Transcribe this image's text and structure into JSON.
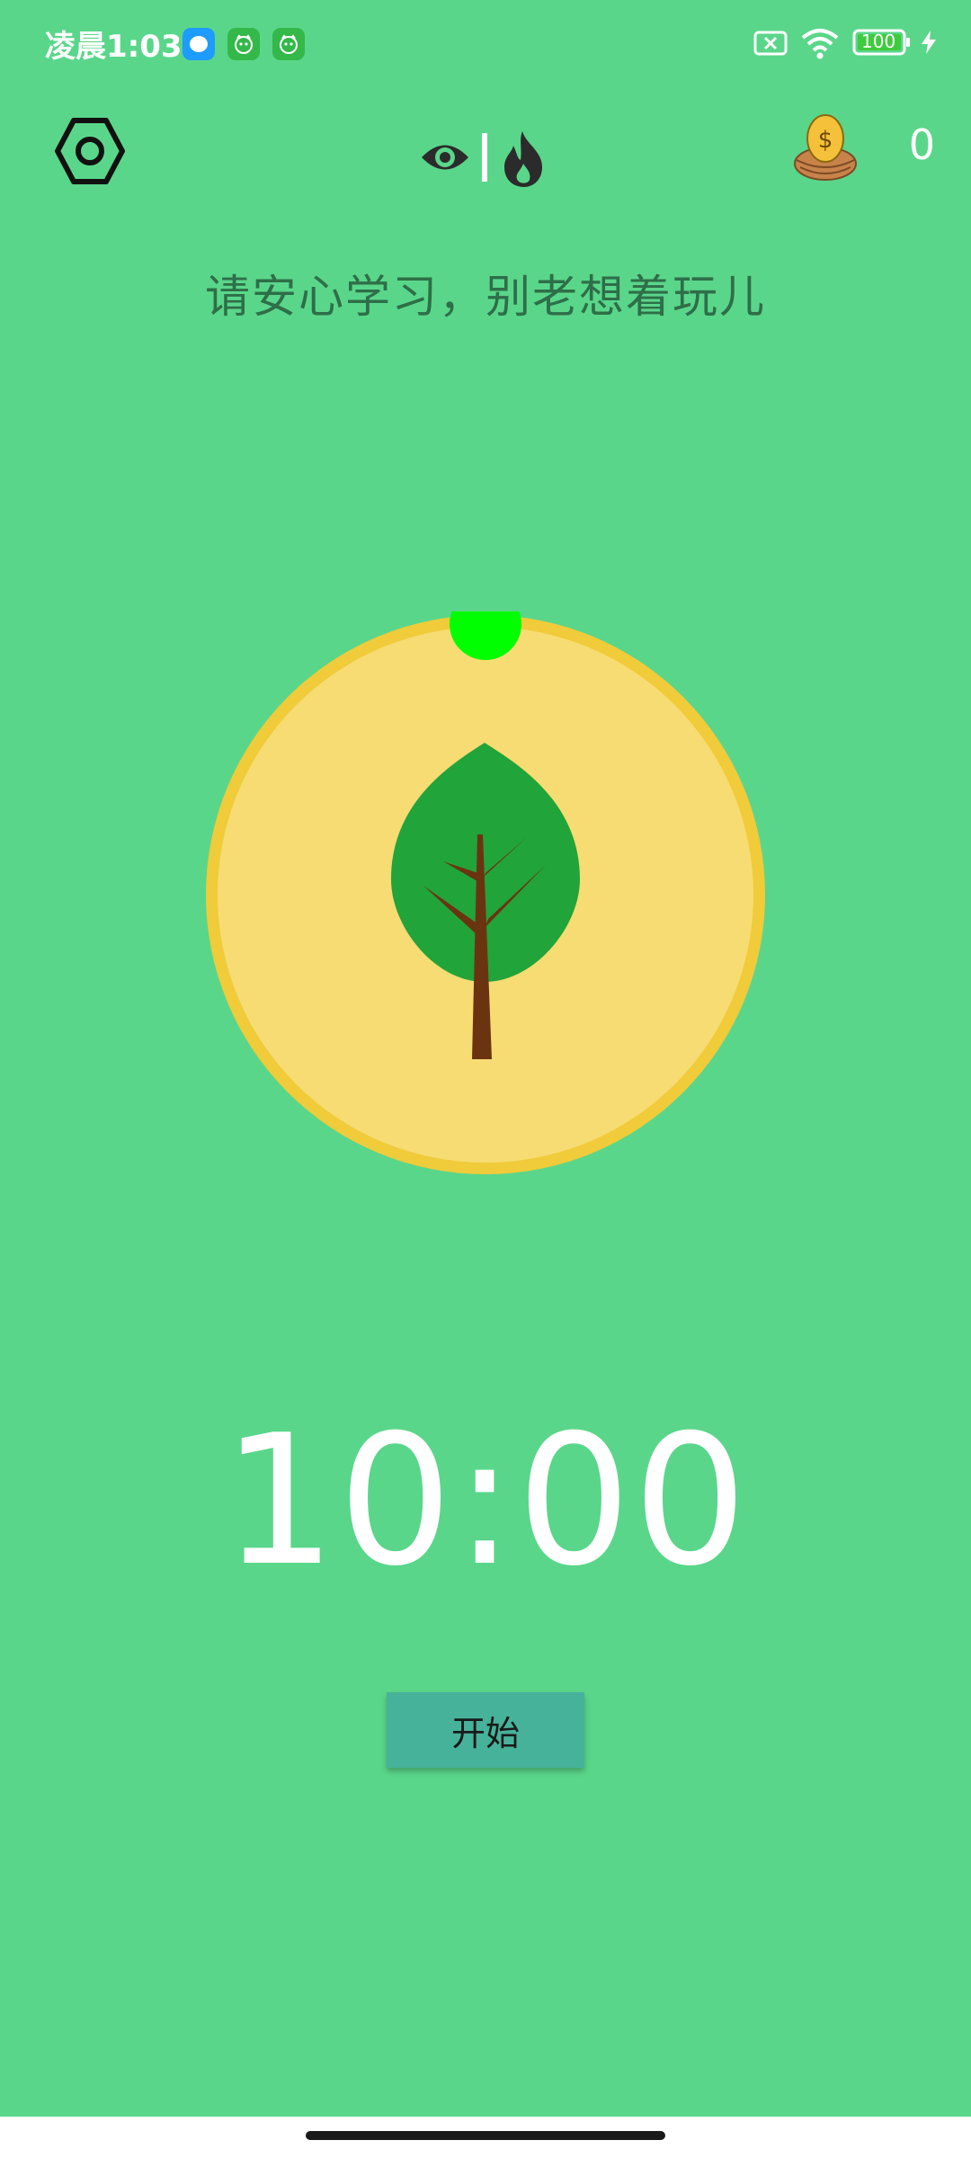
{
  "status_bar": {
    "time": "凌晨1:03",
    "battery": "100",
    "app_icons": [
      "messenger-icon",
      "cat-app-icon",
      "cat-app-icon"
    ],
    "right_icons": [
      "sim-off-icon",
      "wifi-icon",
      "battery-icon",
      "charging-icon"
    ]
  },
  "header": {
    "settings_icon": "hex-settings-icon",
    "mode_icons": [
      "eye-icon",
      "flame-icon"
    ],
    "coin_icon": "coin-egg-nest-icon",
    "coin_count": "0"
  },
  "motto": "请安心学习，别老想着玩儿",
  "dial": {
    "illustration": "tree-icon",
    "handle_icon": "dial-handle"
  },
  "timer": "10:00",
  "start_button": "开始",
  "colors": {
    "background": "#5AD68A",
    "dial_fill": "#F6DC72",
    "dial_ring": "#F0CB3A",
    "handle": "#00FF00",
    "leaf": "#21A43A",
    "trunk": "#6B3410",
    "button": "#47B29A",
    "motto_text": "#2E6E48"
  }
}
